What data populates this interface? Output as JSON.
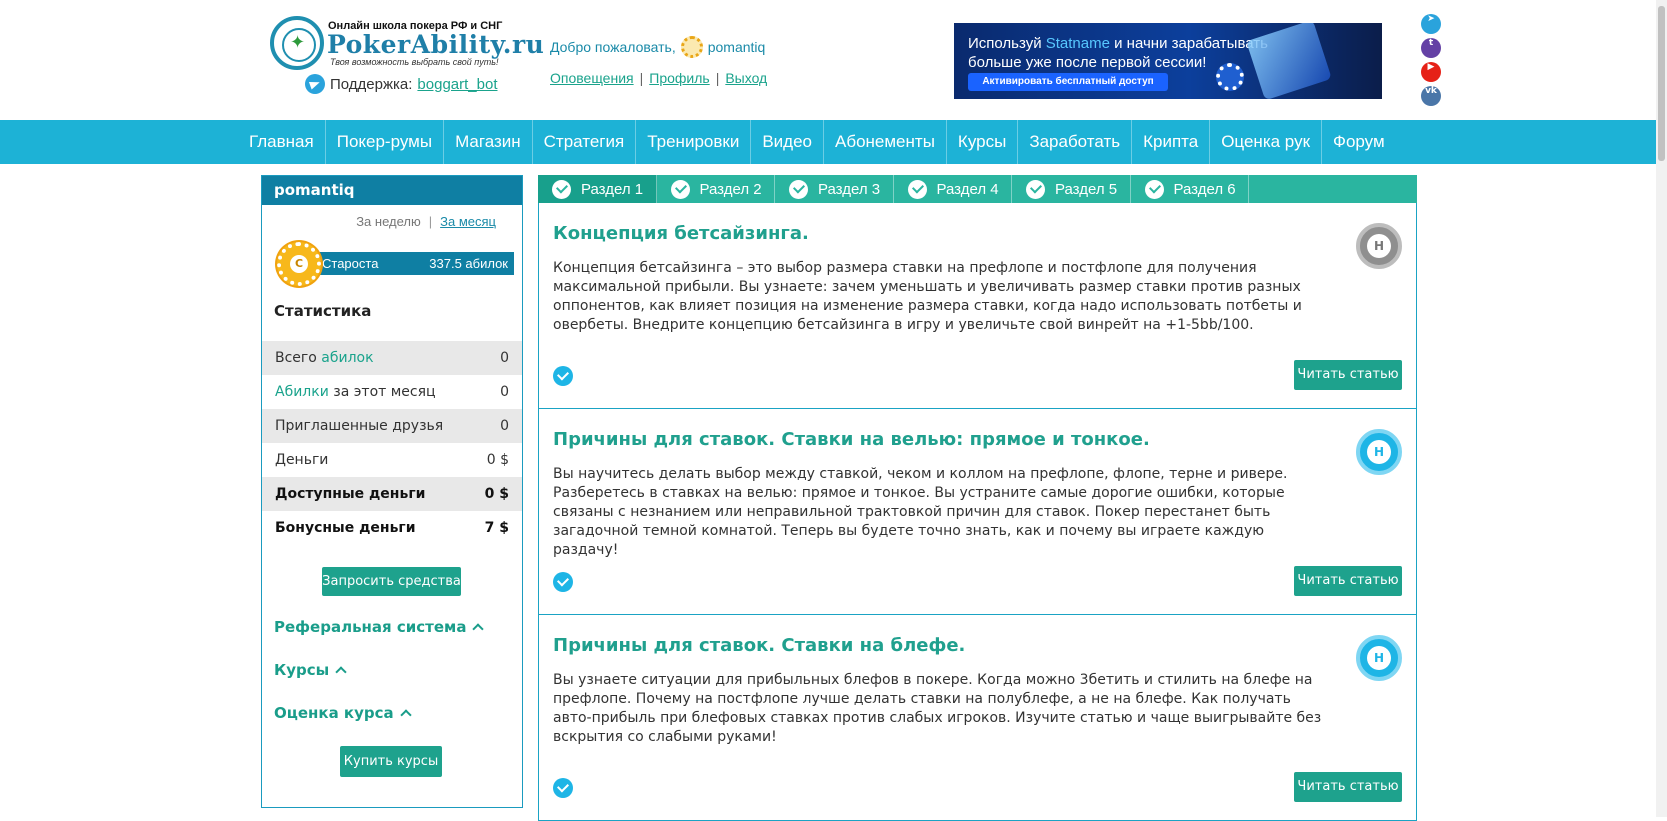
{
  "header": {
    "logo_top": "Онлайн школа покера РФ и СНГ",
    "logo_name": "PokerAbility.ru",
    "logo_tagline": "Твоя возможность выбрать свой путь!",
    "support_label": "Поддержка:",
    "support_link": "boggart_bot",
    "welcome": "Добро пожаловать,",
    "username": "pomantiq",
    "user_links": [
      "Оповещения",
      "Профиль",
      "Выход"
    ],
    "banner": {
      "line1_a": "Используй",
      "line1_brand": "Statname",
      "line1_b": "и начни зарабатывать",
      "line2": "больше уже после первой сессии!",
      "button": "Активировать бесплатный доступ"
    }
  },
  "social": [
    "telegram-icon",
    "twitch-icon",
    "youtube-icon",
    "vk-icon"
  ],
  "nav": [
    "Главная",
    "Покер-румы",
    "Магазин",
    "Стратегия",
    "Тренировки",
    "Видео",
    "Абонементы",
    "Курсы",
    "Заработать",
    "Крипта",
    "Оценка рук",
    "Форум"
  ],
  "sidebar": {
    "username": "pomantiq",
    "period_week": "За неделю",
    "period_month": "За месяц",
    "rank_name": "Староста",
    "rank_value": "337.5 абилок",
    "stats_title": "Статистика",
    "stats": [
      {
        "pre": "Всего ",
        "hl": "абилок",
        "post": "",
        "value": "0"
      },
      {
        "pre": "",
        "hl": "Абилки",
        "post": " за этот месяц",
        "value": "0"
      },
      {
        "pre": "Приглашенные друзья",
        "hl": "",
        "post": "",
        "value": "0"
      },
      {
        "pre": "Деньги",
        "hl": "",
        "post": "",
        "value": "0 $"
      },
      {
        "pre": "Доступные деньги",
        "hl": "",
        "post": "",
        "value": "0 $"
      },
      {
        "pre": "Бонусные деньги",
        "hl": "",
        "post": "",
        "value": "7 $"
      }
    ],
    "request_button": "Запросить средства",
    "sections": [
      "Реферальная система",
      "Курсы",
      "Оценка курса"
    ],
    "buy_button": "Купить курсы"
  },
  "tabs": [
    "Раздел 1",
    "Раздел 2",
    "Раздел 3",
    "Раздел 4",
    "Раздел 5",
    "Раздел 6"
  ],
  "active_tab": "Раздел 1",
  "cards": [
    {
      "title": "Концепция бетсайзинга.",
      "desc": "Концепция бетсайзинга – это выбор размера ставки на префлопе и постфлопе для получения максимальной прибыли. Вы узнаете: зачем уменьшать и увеличивать размер ставки против разных оппонентов, как влияет позиция на изменение размера ставки, когда надо использовать потбеты и овербеты. Внедрите концепцию бетсайзинга в игру и увеличьте свой винрейт на +1-5bb/100.",
      "badge": "Н",
      "badge_color": "#8f8f8f",
      "read": "Читать статью"
    },
    {
      "title": "Причины для ставок. Ставки на велью: прямое и тонкое.",
      "desc": "Вы научитесь делать выбор между ставкой, чеком и коллом на префлопе, флопе, терне и ривере. Разберетесь в ставках на велью: прямое и тонкое. Вы устраните самые дорогие ошибки, которые связаны с незнанием или неправильной трактовкой причин для ставок. Покер перестанет быть загадочной темной комнатой. Теперь вы будете точно знать, как и почему вы играете каждую раздачу!",
      "badge": "Н",
      "badge_color": "#1eb5e6",
      "read": "Читать статью"
    },
    {
      "title": "Причины для ставок. Ставки на блефе.",
      "desc": "Вы узнаете ситуации для прибыльных блефов в покере. Когда можно 3бетить и стилить на блефе на префлопе. Почему на постфлопе лучше делать ставки на полублефе, а не на блефе. Как получать авто-прибыль при блефовых ставках против слабых игроков. Изучите статью и чаще выигрывайте без вскрытия со слабыми руками!",
      "badge": "Н",
      "badge_color": "#1eb5e6",
      "read": "Читать статью"
    }
  ]
}
